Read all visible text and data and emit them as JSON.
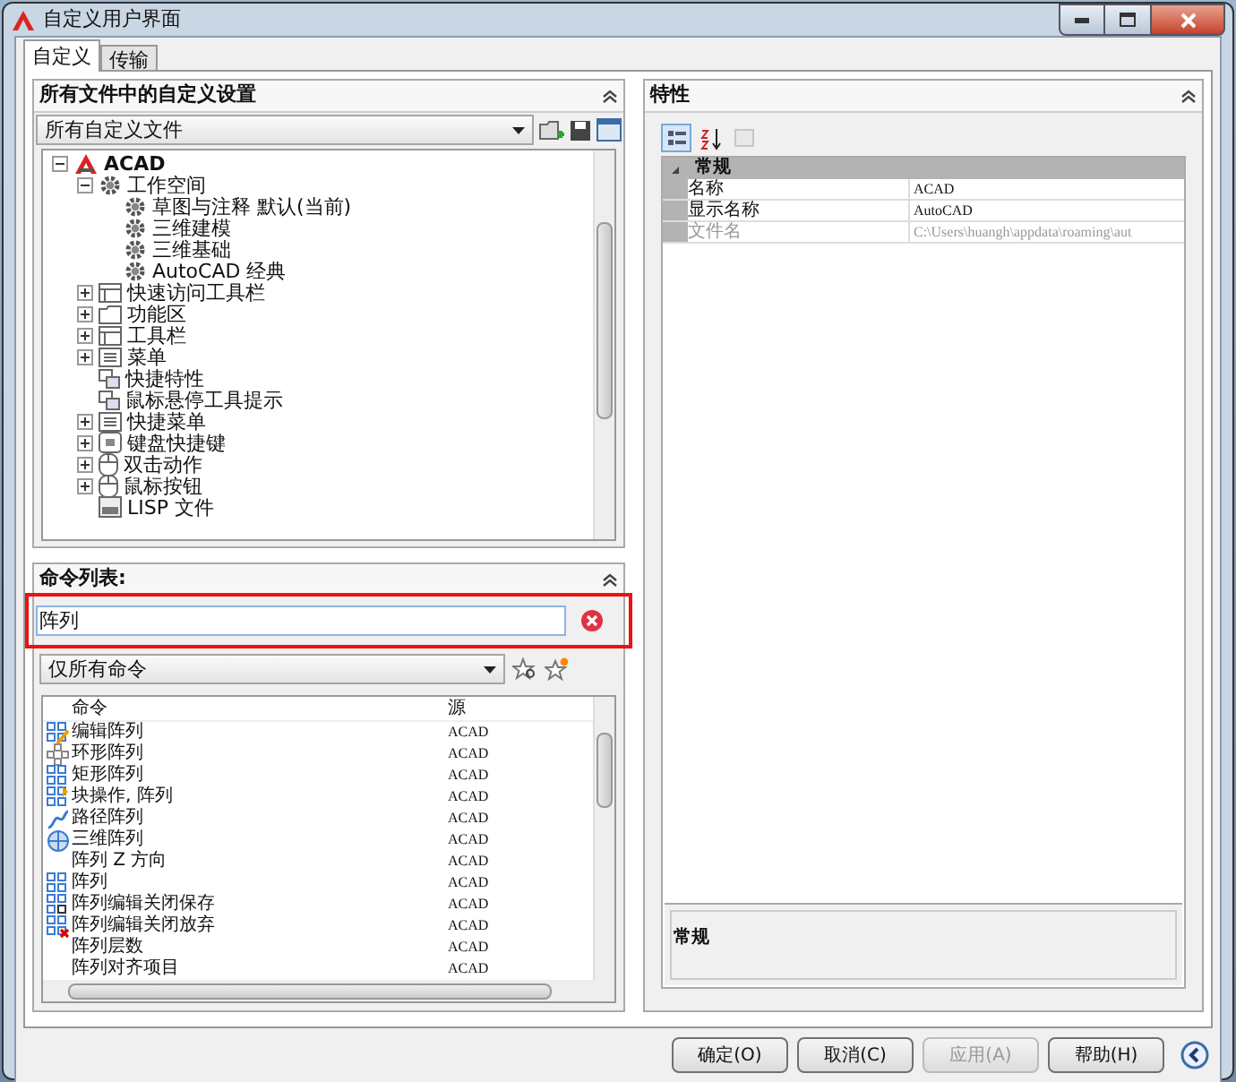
{
  "window": {
    "title": "自定义用户界面"
  },
  "tabs": [
    {
      "label": "自定义",
      "selected": true
    },
    {
      "label": "传输",
      "selected": false
    }
  ],
  "customizations": {
    "header": "所有文件中的自定义设置",
    "file_select": {
      "value": "所有自定义文件"
    },
    "tree": [
      {
        "label": "ACAD",
        "kind": "root",
        "expanded": true,
        "children": [
          {
            "label": "工作空间",
            "kind": "workspace",
            "expanded": true,
            "children": [
              {
                "label": "草图与注释 默认(当前)",
                "kind": "gear"
              },
              {
                "label": "三维建模",
                "kind": "gear"
              },
              {
                "label": "三维基础",
                "kind": "gear"
              },
              {
                "label": "AutoCAD 经典",
                "kind": "gear"
              }
            ]
          },
          {
            "label": "快速访问工具栏",
            "kind": "toolbar",
            "expanded": false
          },
          {
            "label": "功能区",
            "kind": "ribbon",
            "expanded": false
          },
          {
            "label": "工具栏",
            "kind": "toolbar",
            "expanded": false
          },
          {
            "label": "菜单",
            "kind": "menu",
            "expanded": false
          },
          {
            "label": "快捷特性",
            "kind": "leaf"
          },
          {
            "label": "鼠标悬停工具提示",
            "kind": "leaf"
          },
          {
            "label": "快捷菜单",
            "kind": "menu",
            "expanded": false
          },
          {
            "label": "键盘快捷键",
            "kind": "keyboard",
            "expanded": false
          },
          {
            "label": "双击动作",
            "kind": "mouse",
            "expanded": false
          },
          {
            "label": "鼠标按钮",
            "kind": "mouse",
            "expanded": false
          },
          {
            "label": "LISP 文件",
            "kind": "file"
          }
        ]
      }
    ]
  },
  "command_list": {
    "header": "命令列表:",
    "search": {
      "value": "阵列"
    },
    "filter": {
      "value": "仅所有命令"
    },
    "columns": [
      "命令",
      "源"
    ],
    "rows": [
      {
        "name": "编辑阵列",
        "source": "ACAD",
        "kind": "edit"
      },
      {
        "name": "环形阵列",
        "source": "ACAD",
        "kind": "ring"
      },
      {
        "name": "矩形阵列",
        "source": "ACAD",
        "kind": "grid"
      },
      {
        "name": "块操作, 阵列",
        "source": "ACAD",
        "kind": "block"
      },
      {
        "name": "路径阵列",
        "source": "ACAD",
        "kind": "path"
      },
      {
        "name": "三维阵列",
        "source": "ACAD",
        "kind": "cube"
      },
      {
        "name": "阵列 Z 方向",
        "source": "ACAD",
        "kind": "none"
      },
      {
        "name": "阵列",
        "source": "ACAD",
        "kind": "grid"
      },
      {
        "name": "阵列编辑关闭保存",
        "source": "ACAD",
        "kind": "save"
      },
      {
        "name": "阵列编辑关闭放弃",
        "source": "ACAD",
        "kind": "discard"
      },
      {
        "name": "阵列层数",
        "source": "ACAD",
        "kind": "none"
      },
      {
        "name": "阵列对齐项目",
        "source": "ACAD",
        "kind": "none"
      }
    ]
  },
  "properties": {
    "header": "特性",
    "toolbar": [
      {
        "kind": "categorized",
        "selected": true,
        "disabled": false
      },
      {
        "kind": "alphabetic",
        "selected": false,
        "disabled": false
      },
      {
        "kind": "pages",
        "selected": false,
        "disabled": true
      }
    ],
    "category": {
      "label": "常规",
      "expanded": true
    },
    "rows": [
      {
        "name": "名称",
        "value": "ACAD",
        "disabled": false
      },
      {
        "name": "显示名称",
        "value": "AutoCAD",
        "disabled": false
      },
      {
        "name": "文件名",
        "value": "C:\\Users\\huangh\\appdata\\roaming\\aut",
        "disabled": true
      }
    ],
    "description": {
      "title": "常规"
    }
  },
  "buttons": [
    {
      "label": "确定(O)",
      "disabled": false
    },
    {
      "label": "取消(C)",
      "disabled": false
    },
    {
      "label": "应用(A)",
      "disabled": true
    },
    {
      "label": "帮助(H)",
      "disabled": false
    }
  ]
}
